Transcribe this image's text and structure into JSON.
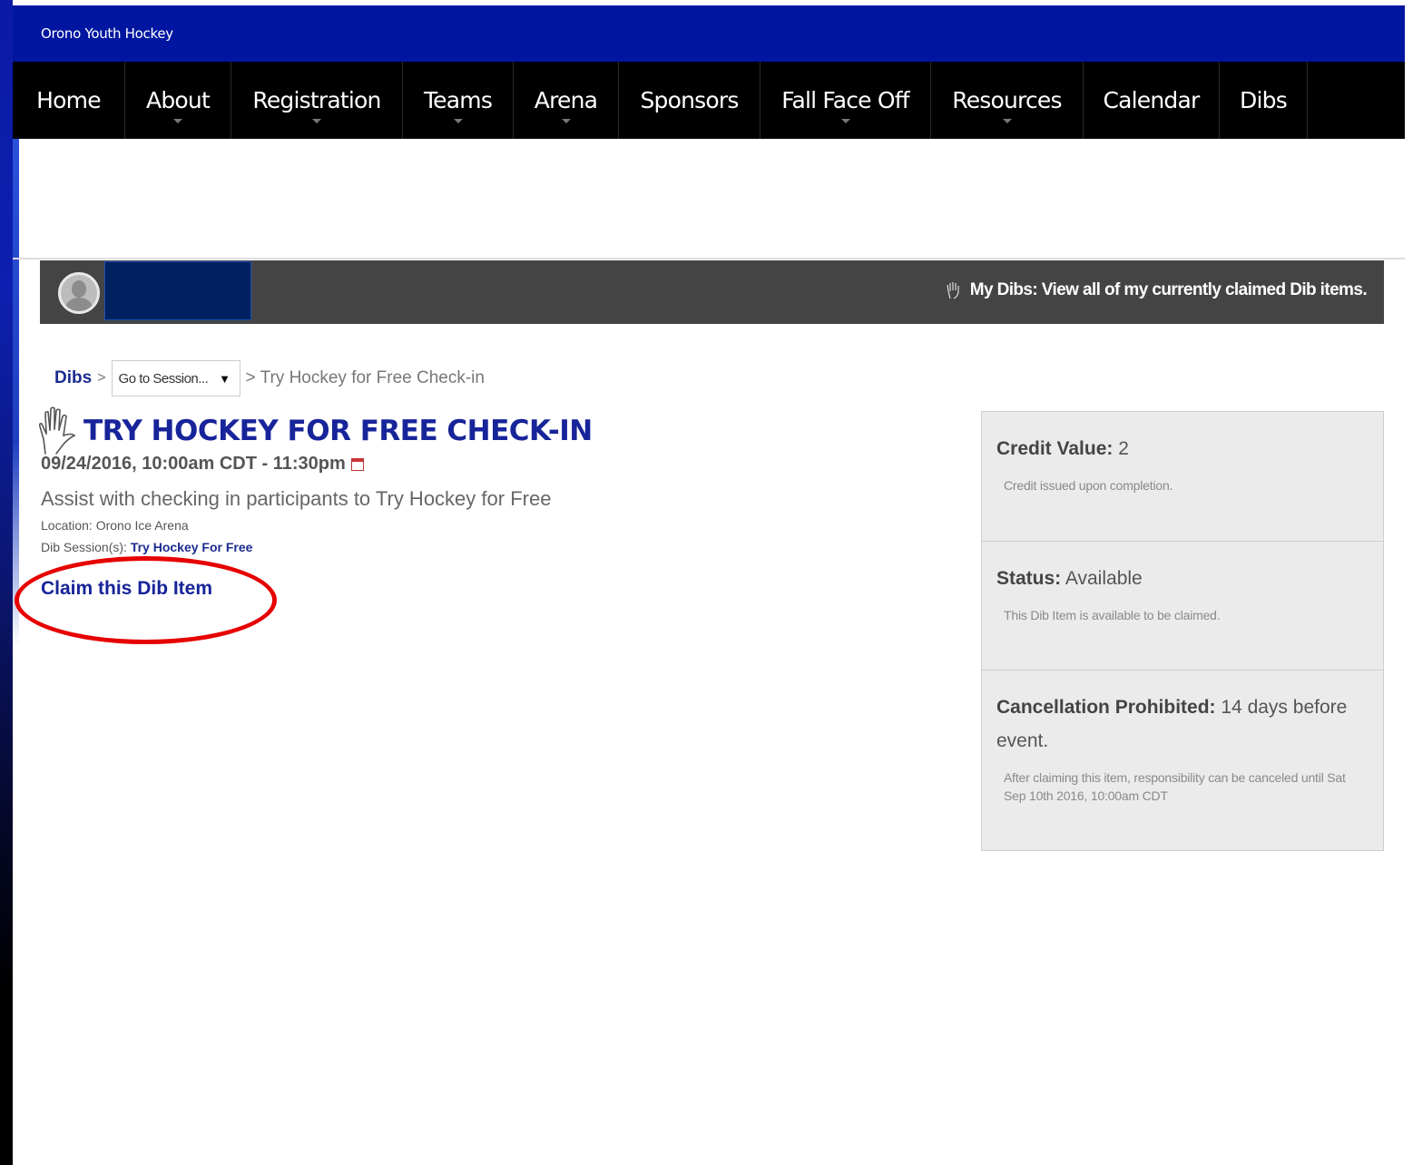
{
  "site": {
    "title": "Orono Youth Hockey"
  },
  "nav": {
    "items": [
      {
        "label": "Home",
        "has_dropdown": false
      },
      {
        "label": "About",
        "has_dropdown": true
      },
      {
        "label": "Registration",
        "has_dropdown": true
      },
      {
        "label": "Teams",
        "has_dropdown": true
      },
      {
        "label": "Arena",
        "has_dropdown": true
      },
      {
        "label": "Sponsors",
        "has_dropdown": false
      },
      {
        "label": "Fall Face Off",
        "has_dropdown": true
      },
      {
        "label": "Resources",
        "has_dropdown": true
      },
      {
        "label": "Calendar",
        "has_dropdown": false
      },
      {
        "label": "Dibs",
        "has_dropdown": false
      }
    ]
  },
  "userbar": {
    "avatar_icon": "user-avatar-icon",
    "my_dibs_label": "My Dibs: View all of my currently claimed Dib items."
  },
  "breadcrumb": {
    "root": "Dibs",
    "separator": ">",
    "select_value": "Go to Session...",
    "current": "> Try Hockey for Free Check-in"
  },
  "item": {
    "title": "Try Hockey for Free Check-in",
    "datetime": "09/24/2016, 10:00am CDT - 11:30pm",
    "description": "Assist with checking in participants to Try Hockey for Free",
    "location": "Location: Orono Ice Arena",
    "session_label": "Dib Session(s):",
    "session_link": "Try Hockey For Free",
    "claim_label": "Claim this Dib Item"
  },
  "info": {
    "credit_label": "Credit Value:",
    "credit_value": "2",
    "credit_note": "Credit issued upon completion.",
    "status_label": "Status:",
    "status_value": "Available",
    "status_note": "This Dib Item is available to be claimed.",
    "cancel_label": "Cancellation Prohibited:",
    "cancel_value": "14 days before event.",
    "cancel_note": "After claiming this item, responsibility can be canceled until Sat Sep 10th 2016, 10:00am CDT"
  },
  "colors": {
    "topbar": "#0016a0",
    "nav_bg": "#000000",
    "accent_blue": "#17249a",
    "annotation_red": "#e60000",
    "userbar_bg": "#444444",
    "panel_bg": "#ebebeb"
  }
}
